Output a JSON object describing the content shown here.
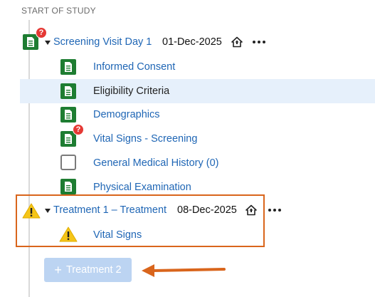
{
  "section": {
    "title": "START OF STUDY"
  },
  "visits": [
    {
      "name": "Screening Visit Day 1",
      "date": "01-Dec-2025",
      "badge": "?",
      "forms": [
        {
          "label": "Informed Consent",
          "icon": "document-icon",
          "link": true
        },
        {
          "label": "Eligibility Criteria",
          "icon": "document-icon",
          "link": false,
          "selected": true
        },
        {
          "label": "Demographics",
          "icon": "document-icon",
          "link": true
        },
        {
          "label": "Vital Signs - Screening",
          "icon": "document-icon",
          "link": true,
          "badge": "?"
        },
        {
          "label": "General Medical History (0)",
          "icon": "empty-checkbox-icon",
          "link": true
        },
        {
          "label": "Physical Examination",
          "icon": "document-icon",
          "link": true
        }
      ]
    },
    {
      "name": "Treatment 1 – Treatment",
      "date": "08-Dec-2025",
      "icon": "warning-icon",
      "forms": [
        {
          "label": "Vital Signs",
          "icon": "warning-icon",
          "link": true
        }
      ]
    }
  ],
  "add_button": {
    "label": "Treatment 2",
    "plus": "+"
  },
  "colors": {
    "form_green": "#1e7d32",
    "link_blue": "#1f66b5",
    "highlight_orange": "#d9651c",
    "warning_yellow": "#f5c518",
    "badge_red": "#e53935",
    "button_disabled": "#bcd4f2"
  }
}
